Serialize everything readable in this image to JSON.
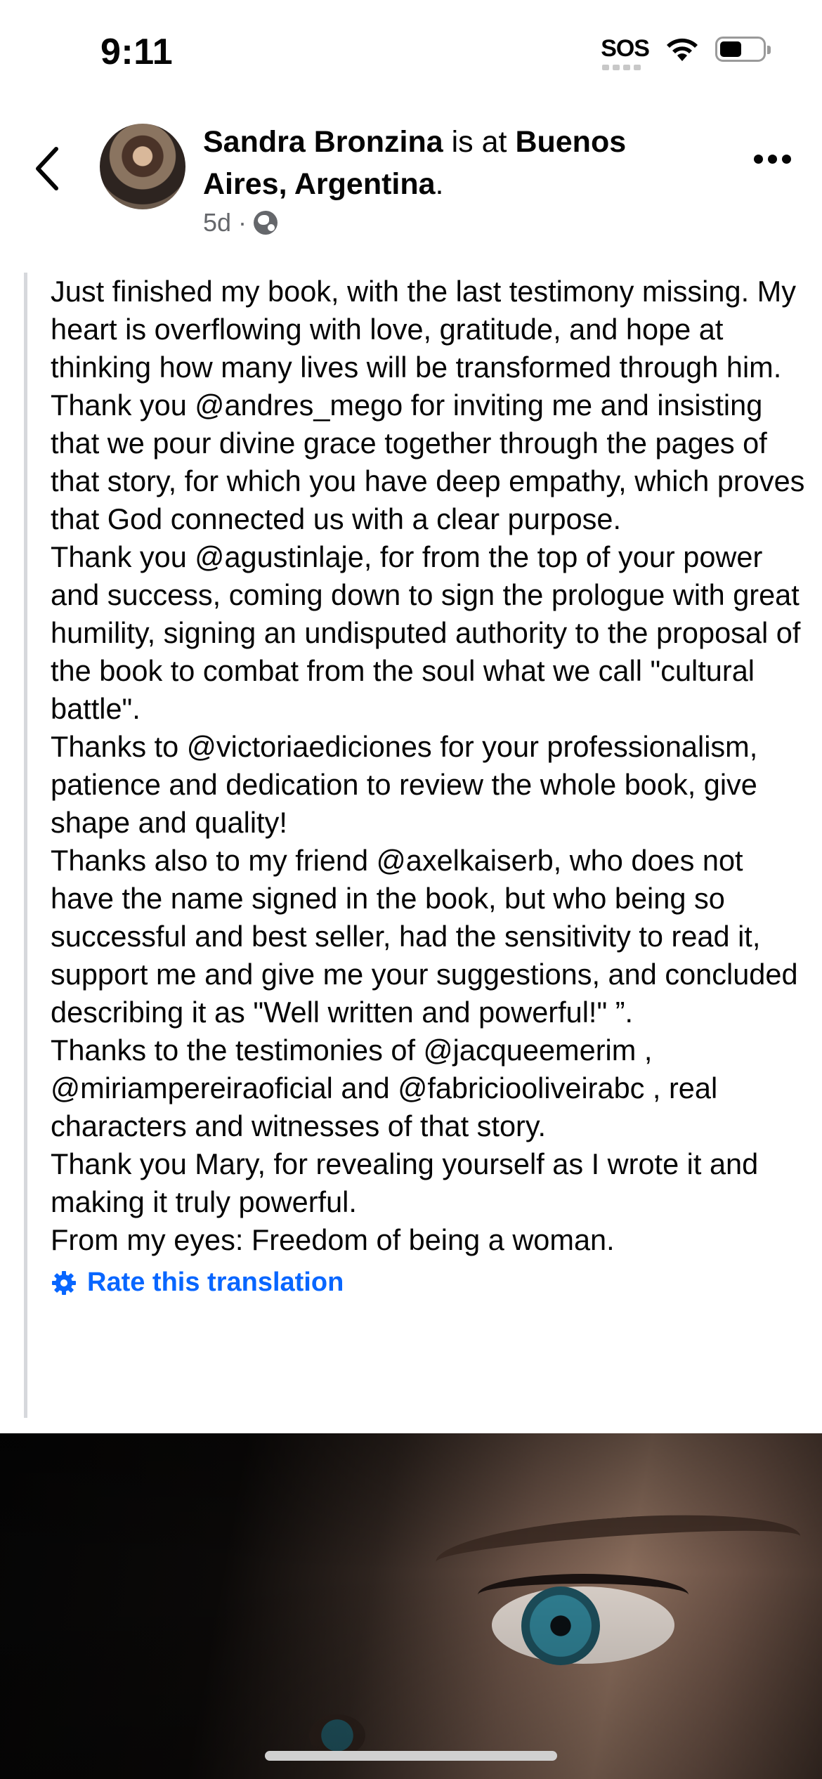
{
  "status_bar": {
    "time": "9:11",
    "sos_label": "SOS",
    "icons": [
      "wifi-icon",
      "battery-icon"
    ]
  },
  "post_header": {
    "author_name": "Sandra Bronzina",
    "connector": " is at ",
    "location": "Buenos Aires, Argentina",
    "location_suffix": ".",
    "timestamp": "5d",
    "separator": "·",
    "privacy_icon": "globe-icon",
    "back_icon": "chevron-left-icon",
    "more_icon": "more-dots-icon"
  },
  "post_body": {
    "paragraphs": [
      "Just finished my book, with the last testimony missing. My heart is overflowing with love, gratitude, and hope at thinking how many lives will be transformed through him.",
      "Thank you @andres_mego for inviting me and insisting that we pour divine grace together through the pages of that story, for which you have deep empathy, which proves that God connected us with a clear purpose.",
      "Thank you @agustinlaje, for from the top of your power and success, coming down to sign the prologue with great humility, signing an undisputed authority to the proposal of the book to combat from the soul what we call \"cultural battle\".",
      "Thanks to @victoriaediciones for your professionalism, patience and dedication to review the whole book, give shape and quality!",
      "Thanks also to my friend @axelkaiserb, who does not have the name signed in the book, but who being so successful and best seller, had the sensitivity to read it, support me and give me your suggestions, and concluded describing it as \"Well written and powerful!\" ”.",
      "Thanks to the testimonies of @jacqueemerim , @miriampereiraoficial and @fabricioolive​irabc , real characters and witnesses of that story.",
      "Thank you Mary, for revealing yourself as I wrote it and making it truly powerful.",
      "From my eyes: Freedom of being a woman."
    ],
    "rate_translation_label": "Rate this translation",
    "rate_icon": "gear-icon"
  },
  "colors": {
    "text": "#050505",
    "secondary_text": "#65676b",
    "link_blue": "#0866ff",
    "quote_bar": "#d6d8dc"
  }
}
